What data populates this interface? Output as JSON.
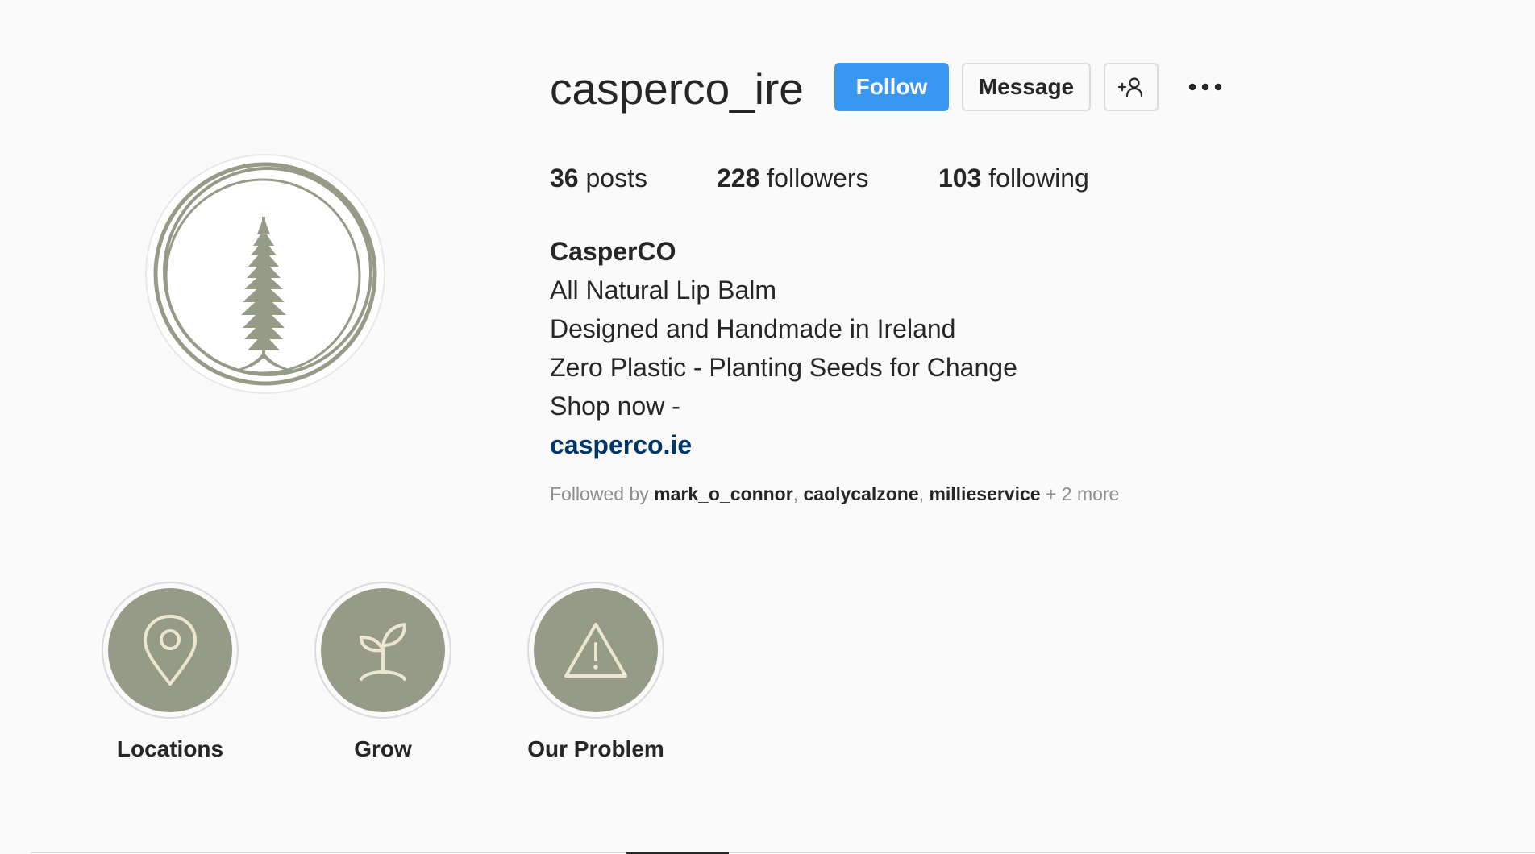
{
  "profile": {
    "username": "casperco_ire",
    "avatar_icon": "pine-tree-logo"
  },
  "actions": {
    "follow_label": "Follow",
    "message_label": "Message",
    "suggest_icon": "add-person-icon",
    "more_icon": "more-options-icon"
  },
  "stats": {
    "posts_count": "36",
    "posts_label": "posts",
    "followers_count": "228",
    "followers_label": "followers",
    "following_count": "103",
    "following_label": "following"
  },
  "bio": {
    "name": "CasperCO",
    "lines": [
      "All Natural Lip Balm",
      "Designed and Handmade in Ireland",
      "Zero Plastic - Planting Seeds for Change",
      "Shop now -"
    ],
    "link": "casperco.ie"
  },
  "followed_by": {
    "prefix": "Followed by",
    "users": [
      "mark_o_connor",
      "caolycalzone",
      "millieservice"
    ],
    "more": "+ 2 more"
  },
  "highlights": [
    {
      "label": "Locations",
      "icon": "location-pin-icon"
    },
    {
      "label": "Grow",
      "icon": "sprout-icon"
    },
    {
      "label": "Our Problem",
      "icon": "warning-triangle-icon"
    }
  ],
  "colors": {
    "follow_button": "#3897f0",
    "link": "#003569",
    "highlight_fill": "#969b88",
    "highlight_icon": "#ece6cf",
    "logo": "#969b88"
  }
}
